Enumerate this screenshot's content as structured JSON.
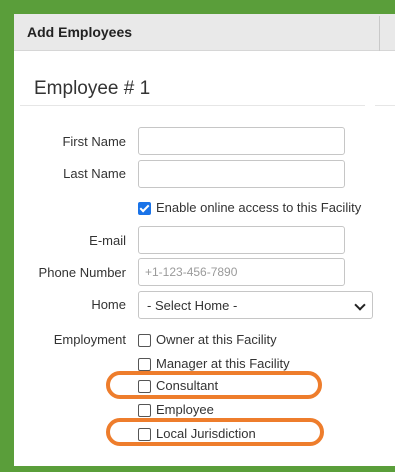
{
  "header": {
    "title": "Add Employees"
  },
  "section": {
    "title": "Employee # 1"
  },
  "form": {
    "first_name": {
      "label": "First Name",
      "value": ""
    },
    "last_name": {
      "label": "Last Name",
      "value": ""
    },
    "online_access": {
      "label": "Enable online access to this Facility",
      "checked": true
    },
    "email": {
      "label": "E-mail",
      "value": ""
    },
    "phone": {
      "label": "Phone Number",
      "placeholder": "+1-123-456-7890",
      "value": ""
    },
    "home": {
      "label": "Home",
      "selected": "- Select Home -"
    },
    "employment": {
      "label": "Employment",
      "options": [
        {
          "label": "Owner at this Facility",
          "checked": false
        },
        {
          "label": "Manager at this Facility",
          "checked": false
        },
        {
          "label": "Consultant",
          "checked": false,
          "highlighted": true
        },
        {
          "label": "Employee",
          "checked": false
        },
        {
          "label": "Local Jurisdiction",
          "checked": false,
          "highlighted": true
        }
      ]
    }
  },
  "colors": {
    "frame": "#5a9e3a",
    "header_bg": "#e9e9e9",
    "highlight": "#ee7d2c",
    "checkbox_checked": "#1a73e8"
  }
}
